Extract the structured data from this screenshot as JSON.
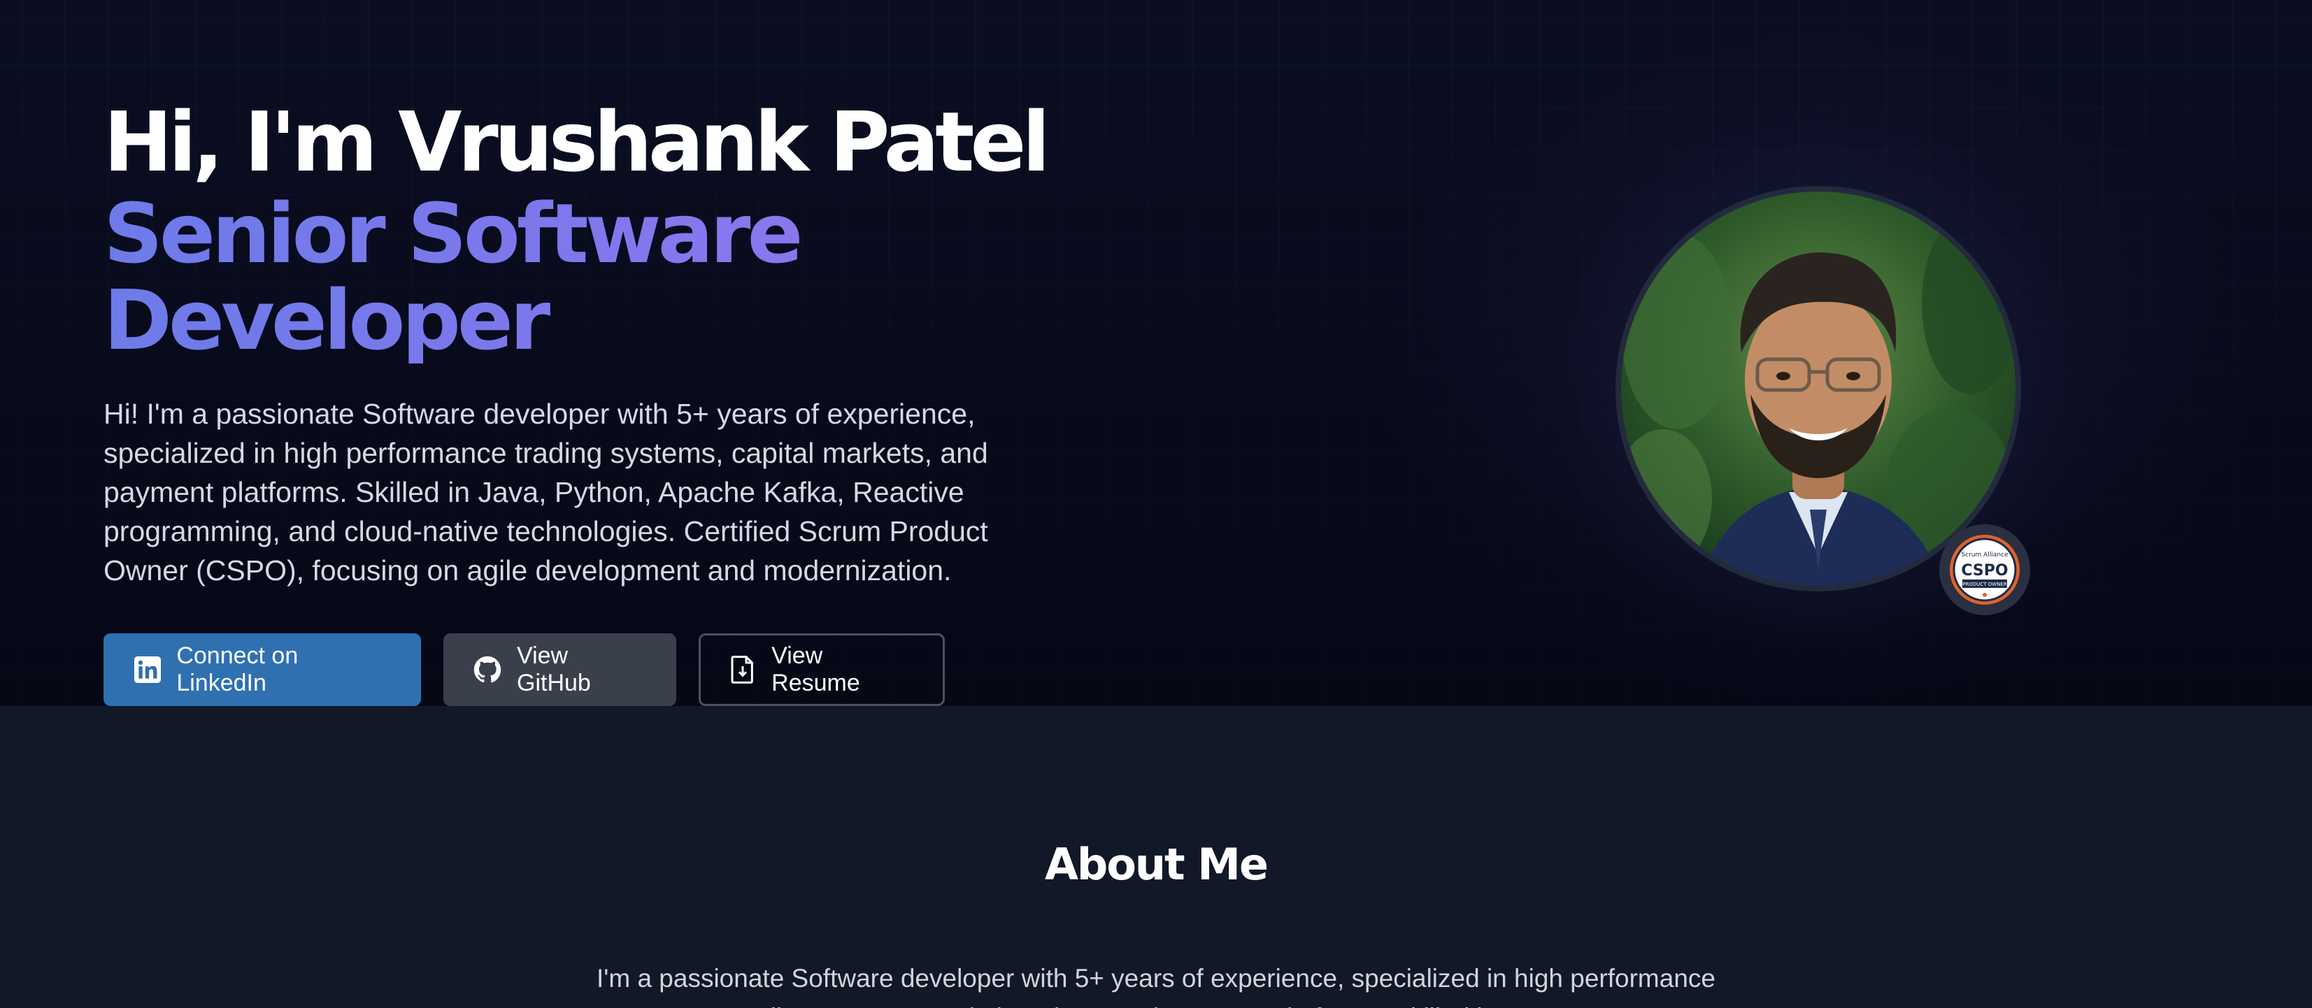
{
  "hero": {
    "greeting": "Hi, I'm Vrushank Patel",
    "role": "Senior Software Developer",
    "intro": "Hi! I'm a passionate Software developer with 5+ years of experience, specialized in high performance trading systems, capital markets, and payment platforms. Skilled in Java, Python, Apache Kafka, Reactive programming, and cloud-native technologies. Certified Scrum Product Owner (CSPO), focusing on agile development and modernization.",
    "buttons": {
      "linkedin": {
        "label": "Connect on LinkedIn",
        "icon": "linkedin-icon",
        "color": "#2f70b0"
      },
      "github": {
        "label": "View GitHub",
        "icon": "github-icon",
        "color": "#3a3f4c"
      },
      "resume": {
        "label": "View Resume",
        "icon": "document-icon"
      }
    },
    "badge": {
      "org": "Scrum Alliance",
      "title": "CSPO",
      "subtitle": "PRODUCT OWNER"
    },
    "accent_color": "#6f78ee"
  },
  "about": {
    "title": "About Me",
    "text": "I'm a passionate Software developer with 5+ years of experience, specialized in high performance trading systems, capital markets, and payment platforms. Skilled in Java..."
  }
}
